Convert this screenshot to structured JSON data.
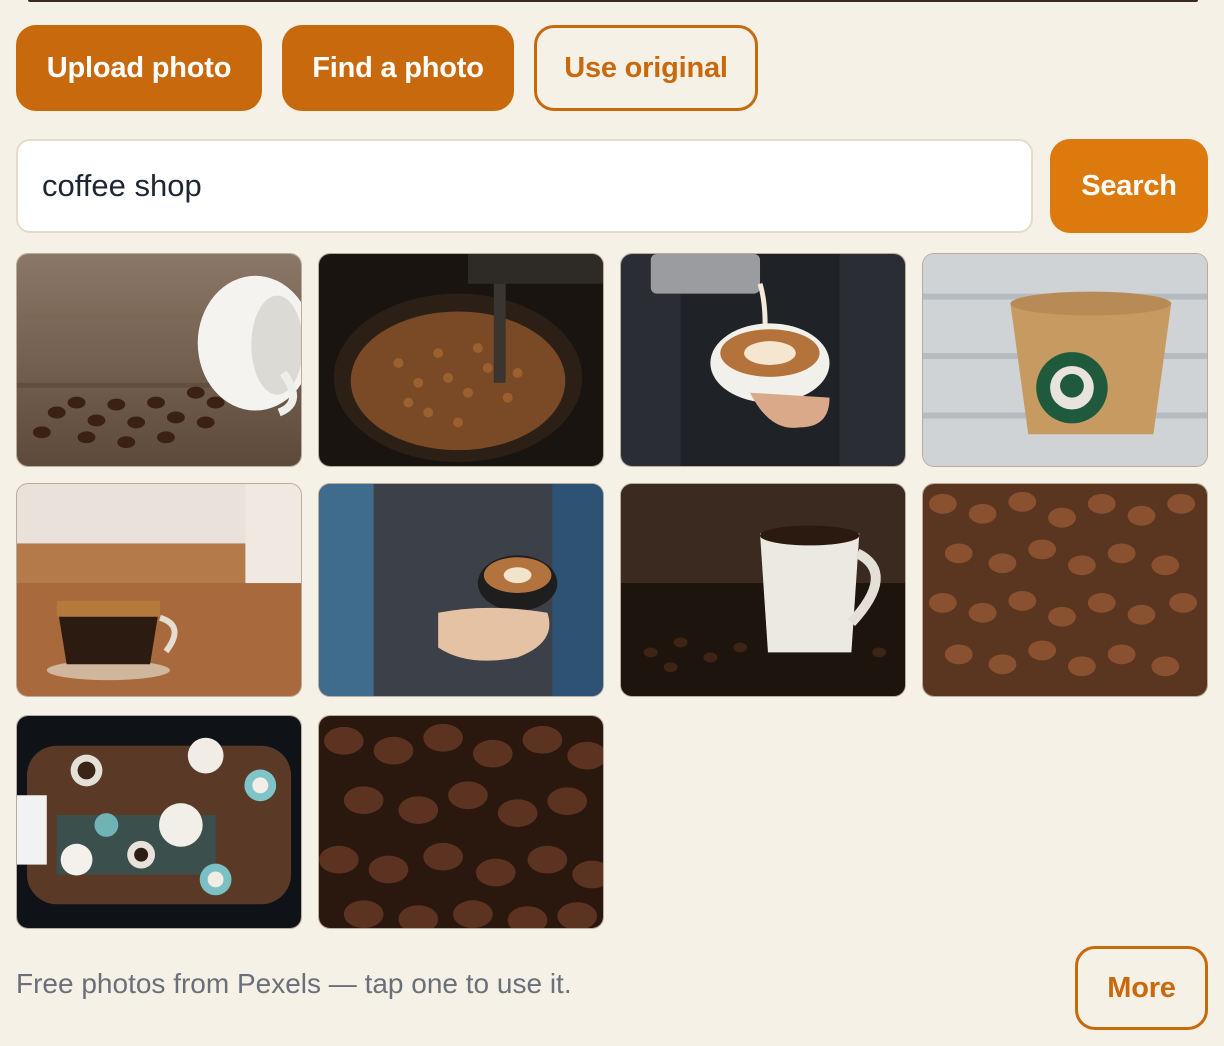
{
  "actions": {
    "upload_label": "Upload photo",
    "find_label": "Find a photo",
    "original_label": "Use original"
  },
  "search": {
    "value": "coffee shop",
    "button_label": "Search"
  },
  "results": [
    {
      "name": "photo-cup-spilled-beans"
    },
    {
      "name": "photo-roaster-beans"
    },
    {
      "name": "photo-latte-pour"
    },
    {
      "name": "photo-starbucks-sleeve"
    },
    {
      "name": "photo-espresso-glass"
    },
    {
      "name": "photo-barista-latte"
    },
    {
      "name": "photo-white-mug-beans"
    },
    {
      "name": "photo-beans-closeup"
    },
    {
      "name": "photo-cafe-table-overhead"
    },
    {
      "name": "photo-dark-beans"
    }
  ],
  "footer": {
    "note": "Free photos from Pexels — tap one to use it.",
    "more_label": "More"
  },
  "colors": {
    "accent": "#c9690d",
    "search_button": "#dd7a0e",
    "background": "#f6f1e7"
  }
}
